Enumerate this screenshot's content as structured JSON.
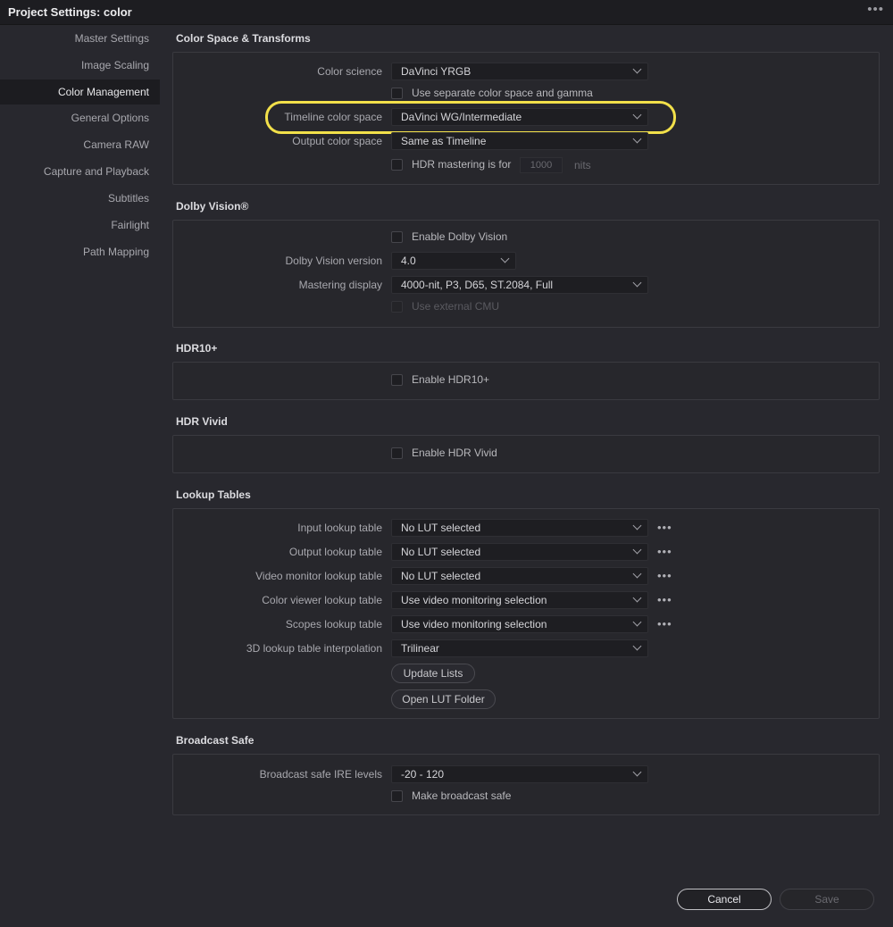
{
  "window": {
    "title": "Project Settings:  color",
    "more_icon": "more-horizontal-icon"
  },
  "sidebar": {
    "items": [
      {
        "label": "Master Settings"
      },
      {
        "label": "Image Scaling"
      },
      {
        "label": "Color Management"
      },
      {
        "label": "General Options"
      },
      {
        "label": "Camera RAW"
      },
      {
        "label": "Capture and Playback"
      },
      {
        "label": "Subtitles"
      },
      {
        "label": "Fairlight"
      },
      {
        "label": "Path Mapping"
      }
    ],
    "active": "Color Management"
  },
  "color_space": {
    "title": "Color Space & Transforms",
    "color_science_label": "Color science",
    "color_science_value": "DaVinci YRGB",
    "separate_label": "Use separate color space and gamma",
    "timeline_label": "Timeline color space",
    "timeline_value": "DaVinci WG/Intermediate",
    "output_label": "Output color space",
    "output_value": "Same as Timeline",
    "hdr_label": "HDR mastering is for",
    "hdr_value": "1000",
    "hdr_unit": "nits",
    "highlight_color": "#f2e04a"
  },
  "dolby": {
    "title": "Dolby Vision®",
    "enable_label": "Enable Dolby Vision",
    "version_label": "Dolby Vision version",
    "version_value": "4.0",
    "mastering_label": "Mastering display",
    "mastering_value": "4000-nit, P3, D65, ST.2084, Full",
    "external_cmu_label": "Use external CMU"
  },
  "hdr10": {
    "title": "HDR10+",
    "enable_label": "Enable HDR10+"
  },
  "hdr_vivid": {
    "title": "HDR Vivid",
    "enable_label": "Enable HDR Vivid"
  },
  "lut": {
    "title": "Lookup Tables",
    "input_label": "Input lookup table",
    "input_value": "No LUT selected",
    "output_label": "Output lookup table",
    "output_value": "No LUT selected",
    "video_monitor_label": "Video monitor lookup table",
    "video_monitor_value": "No LUT selected",
    "color_viewer_label": "Color viewer lookup table",
    "color_viewer_value": "Use video monitoring selection",
    "scopes_label": "Scopes lookup table",
    "scopes_value": "Use video monitoring selection",
    "interp_label": "3D lookup table interpolation",
    "interp_value": "Trilinear",
    "update_lists": "Update Lists",
    "open_folder": "Open LUT Folder",
    "dots": "•••"
  },
  "broadcast": {
    "title": "Broadcast Safe",
    "ire_label": "Broadcast safe IRE levels",
    "ire_value": "-20 - 120",
    "make_safe_label": "Make broadcast safe"
  },
  "footer": {
    "cancel": "Cancel",
    "save": "Save"
  }
}
